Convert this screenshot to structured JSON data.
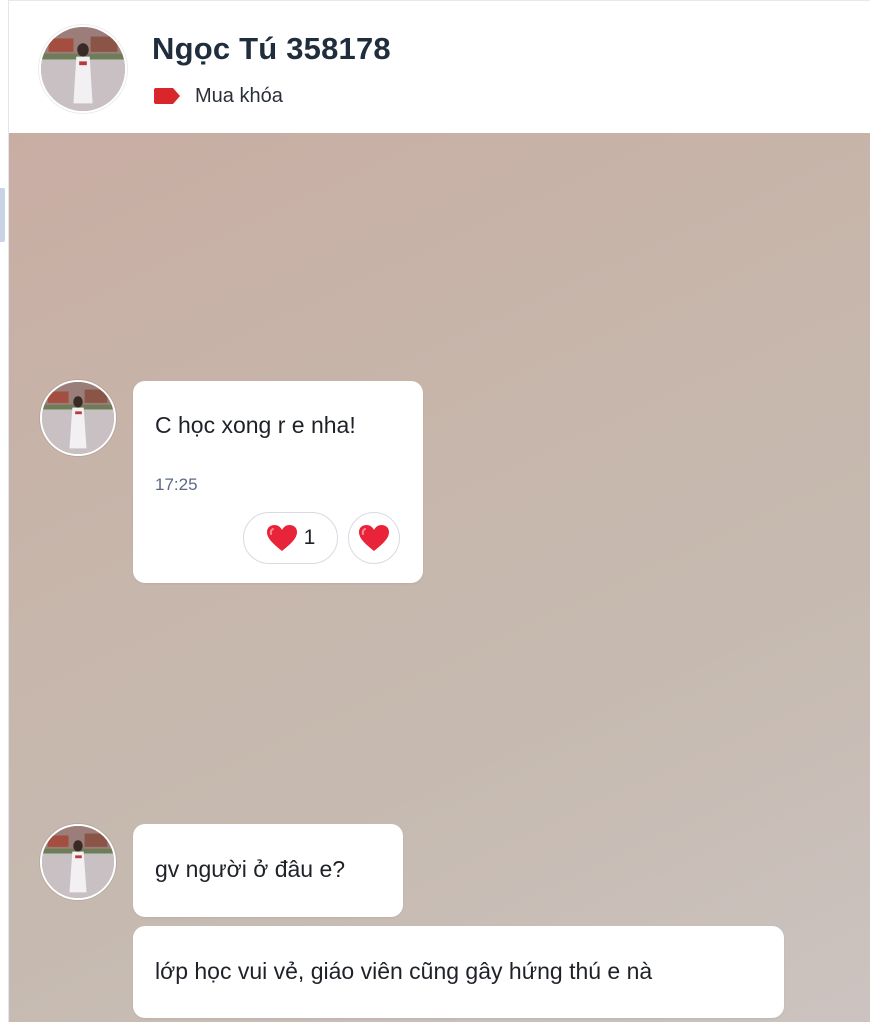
{
  "header": {
    "contact_name": "Ngọc Tú 358178",
    "tag_label": "Mua khóa",
    "tag_color": "#d9262b"
  },
  "messages": [
    {
      "text": "C học xong r e nha!",
      "time": "17:25",
      "reactions": [
        {
          "emoji": "heart-icon",
          "count": "1"
        },
        {
          "emoji": "heart-icon",
          "count": ""
        }
      ]
    },
    {
      "text": "gv người ở đâu e?"
    },
    {
      "text": "lớp học vui vẻ, giáo viên cũng gây hứng thú e nà"
    }
  ],
  "colors": {
    "heart": "#e8233a",
    "name": "#1f2d3d",
    "time": "#5a6a85"
  }
}
